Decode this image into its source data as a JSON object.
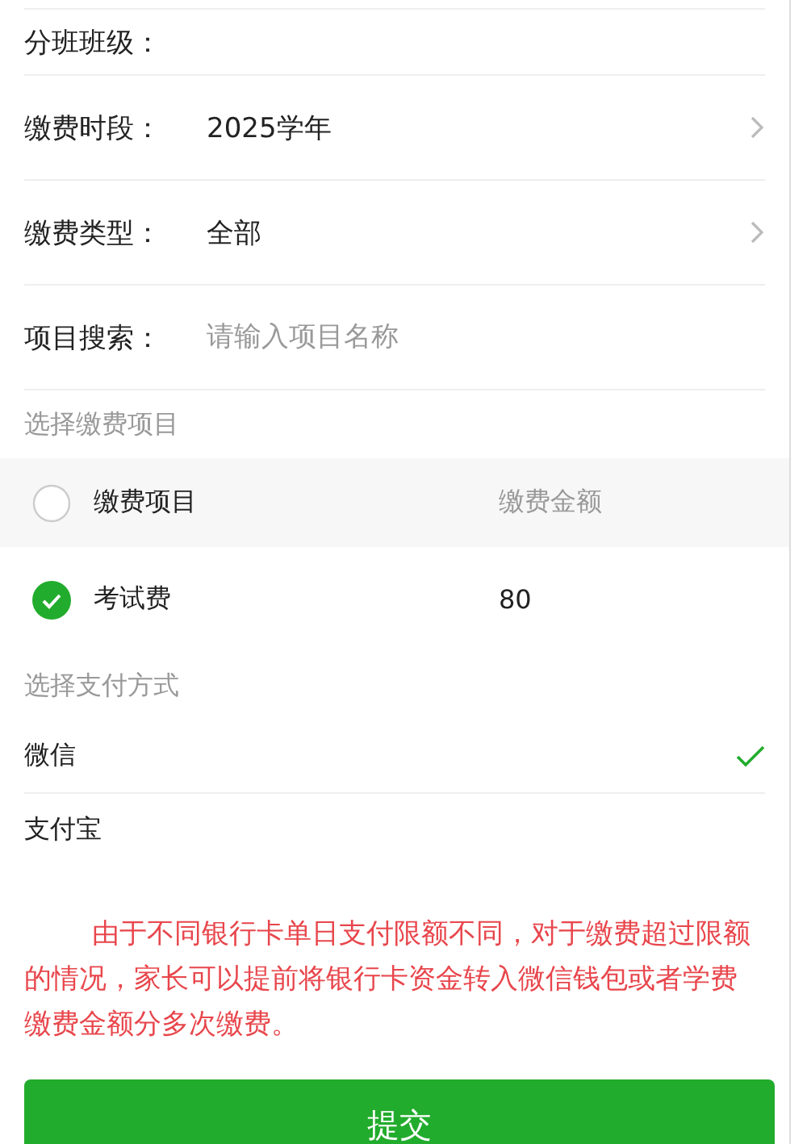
{
  "fields": [
    {
      "kind": "text",
      "label": "分班班级："
    },
    {
      "kind": "select",
      "label": "缴费时段：",
      "value": "2025学年"
    },
    {
      "kind": "select",
      "label": "缴费类型：",
      "value": "全部"
    },
    {
      "kind": "search",
      "label": "项目搜索：",
      "placeholder": "请输入项目名称"
    }
  ],
  "fee_section": {
    "title": "选择缴费项目",
    "header": {
      "checked": false,
      "item": "缴费项目",
      "amount": "缴费金额"
    },
    "items": [
      {
        "checked": true,
        "name": "考试费",
        "amount": "80"
      }
    ]
  },
  "payment_section": {
    "title": "选择支付方式",
    "methods": [
      {
        "name": "微信",
        "selected": true
      },
      {
        "name": "支付宝",
        "selected": false
      }
    ]
  },
  "notice": "由于不同银行卡单日支付限额不同，对于缴费超过限额的情况，家长可以提前将银行卡资金转入微信钱包或者学费缴费金额分多次缴费。",
  "submit_button": "提交"
}
